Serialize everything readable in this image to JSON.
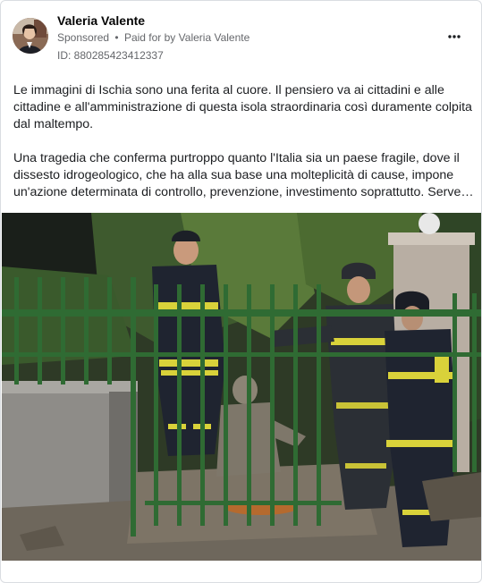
{
  "post": {
    "author": "Valeria Valente",
    "sponsored_label": "Sponsored",
    "separator": "•",
    "paid_for_prefix": "Paid for by",
    "payer": "Valeria Valente",
    "ad_id": "ID: 880285423412337",
    "more_icon": "more-horizontal-icon",
    "paragraph_1": "Le immagini di Ischia sono una ferita al cuore. Il pensiero va ai cittadini e alle cittadine e all'amministrazione di questa isola straordinaria così duramente colpita dal maltempo.",
    "paragraph_2_line_1": "Una tragedia che conferma purtroppo quanto l'Italia sia un paese fragile, dove il",
    "paragraph_2_line_2": "dissesto idrogeologico, che ha alla sua base una molteplicità di cause, impone",
    "paragraph_2_line_3": "un'azione determinata di controllo, prevenzione, investimento soprattutto. Serve un intervento"
  },
  "colors": {
    "secondary_text": "#65676b",
    "border": "#dadde1",
    "firefighter_uniform": "#1f2430",
    "reflective_stripe": "#d9d23a",
    "fence_green": "#2f6b33",
    "mud": "#7d7466"
  }
}
